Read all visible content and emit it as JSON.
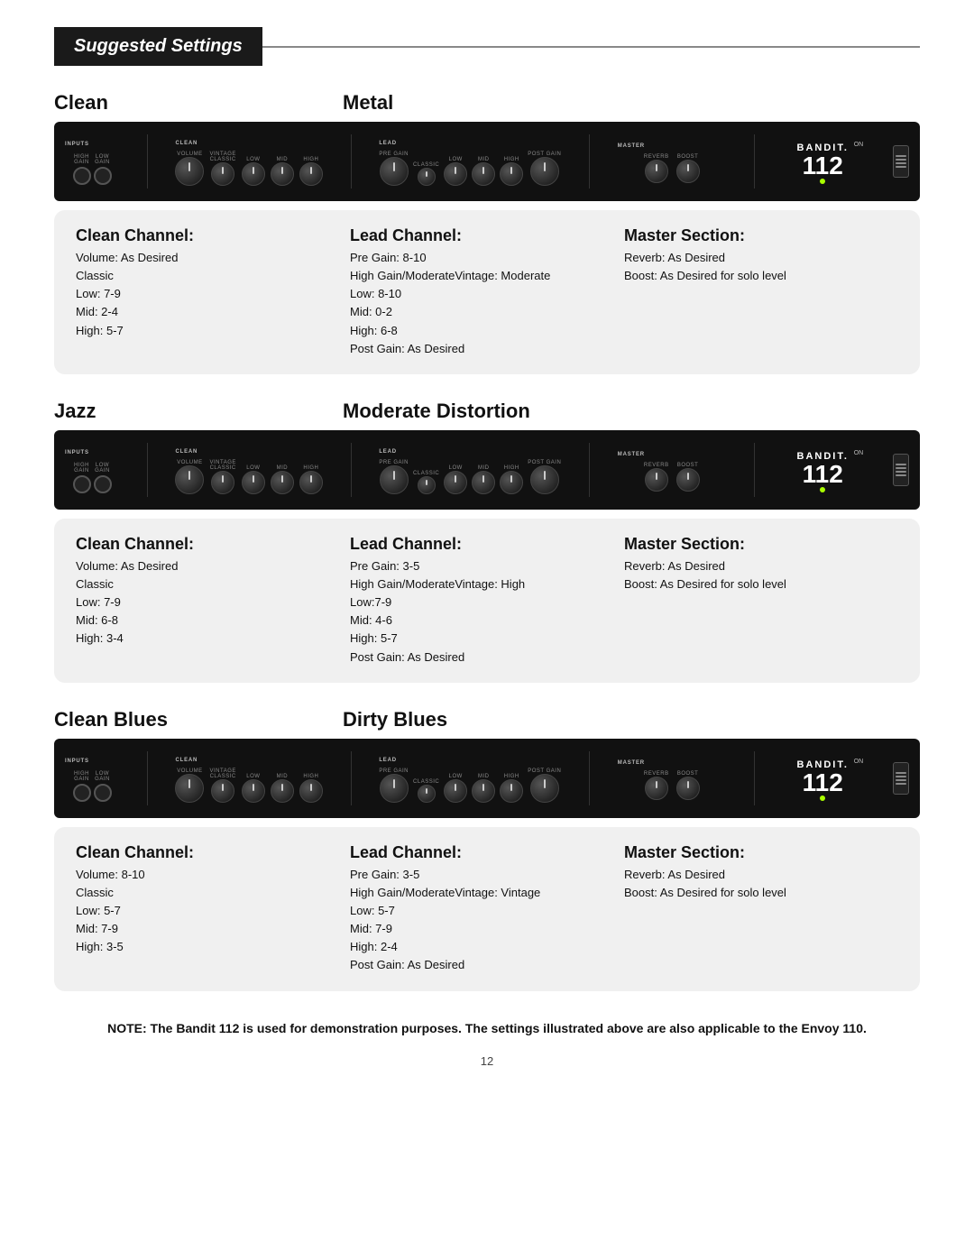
{
  "header": {
    "title": "Suggested Settings"
  },
  "presets": [
    {
      "id": "clean-metal",
      "left_label": "Clean",
      "right_label": "Metal",
      "clean_channel": {
        "title": "Clean Channel:",
        "lines": [
          "Volume: As Desired",
          "Classic",
          "Low: 7-9",
          "Mid: 2-4",
          "High: 5-7"
        ]
      },
      "lead_channel": {
        "title": "Lead Channel:",
        "lines": [
          "Pre Gain: 8-10",
          "High Gain/ModerateVintage: Moderate",
          "Low: 8-10",
          "Mid: 0-2",
          "High: 6-8",
          "Post Gain: As Desired"
        ]
      },
      "master_section": {
        "title": "Master Section:",
        "lines": [
          "Reverb: As Desired",
          "Boost: As Desired for solo level"
        ]
      }
    },
    {
      "id": "jazz-moderate",
      "left_label": "Jazz",
      "right_label": "Moderate Distortion",
      "clean_channel": {
        "title": "Clean Channel:",
        "lines": [
          "Volume: As Desired",
          "Classic",
          "Low: 7-9",
          "Mid: 6-8",
          "High: 3-4"
        ]
      },
      "lead_channel": {
        "title": "Lead Channel:",
        "lines": [
          "Pre Gain: 3-5",
          "High Gain/ModerateVintage: High",
          "Low:7-9",
          "Mid: 4-6",
          "High: 5-7",
          "Post Gain: As Desired"
        ]
      },
      "master_section": {
        "title": "Master Section:",
        "lines": [
          "Reverb: As Desired",
          "Boost: As Desired for solo level"
        ]
      }
    },
    {
      "id": "cleanblues-dirtyblues",
      "left_label": "Clean Blues",
      "right_label": "Dirty Blues",
      "clean_channel": {
        "title": "Clean Channel:",
        "lines": [
          "Volume: 8-10",
          "Classic",
          "Low: 5-7",
          "Mid: 7-9",
          "High: 3-5"
        ]
      },
      "lead_channel": {
        "title": "Lead Channel:",
        "lines": [
          "Pre Gain: 3-5",
          "High Gain/ModerateVintage: Vintage",
          "Low: 5-7",
          "Mid: 7-9",
          "High: 2-4",
          "Post Gain: As Desired"
        ]
      },
      "master_section": {
        "title": "Master Section:",
        "lines": [
          "Reverb: As Desired",
          "Boost: As Desired for solo level"
        ]
      }
    }
  ],
  "bottom_note": "NOTE: The Bandit 112 is used for demonstration purposes.  The settings illustrated above are also applicable to the Envoy 110.",
  "page_number": "12",
  "bandit": {
    "brand": "BANDIT.",
    "model": "112"
  }
}
